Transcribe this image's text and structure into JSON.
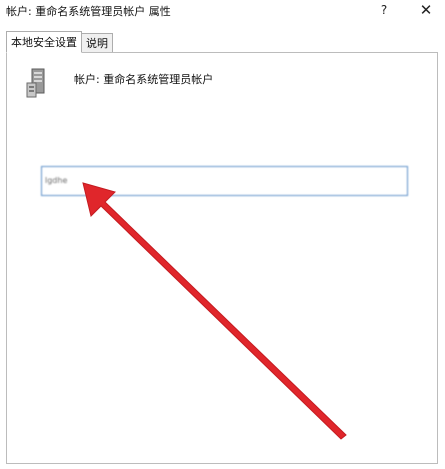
{
  "window": {
    "title": "帐户: 重命名系统管理员帐户 属性",
    "help_label": "?",
    "close_label": "✕"
  },
  "tabs": [
    {
      "label": "本地安全设置",
      "active": true
    },
    {
      "label": "说明",
      "active": false
    }
  ],
  "panel": {
    "icon": "server-icon",
    "account_label": "帐户: 重命名系统管理员帐户",
    "input_value": "lgdhe"
  },
  "annotation": {
    "arrow_color": "#e0262b"
  }
}
